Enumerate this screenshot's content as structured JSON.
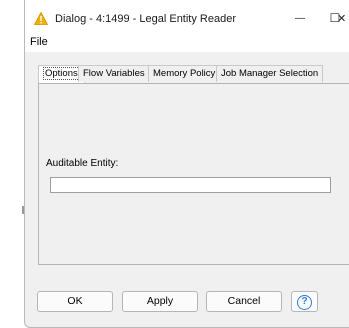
{
  "window": {
    "title": "Dialog - 4:1499 - Legal Entity Reader",
    "minimize_glyph": "—",
    "maximize_glyph": "☐",
    "close_glyph": "✕",
    "icon": "warning-triangle-icon",
    "accent_color": "#f0b400"
  },
  "menu": {
    "items": [
      {
        "label": "File"
      }
    ]
  },
  "tabs": [
    {
      "label": "Options",
      "active": true
    },
    {
      "label": "Flow Variables"
    },
    {
      "label": "Memory Policy"
    },
    {
      "label": "Job Manager Selection"
    }
  ],
  "options": {
    "auditable_entity_label": "Auditable Entity:",
    "auditable_entity_value": ""
  },
  "buttons": {
    "ok": "OK",
    "apply": "Apply",
    "cancel": "Cancel",
    "help": "?"
  }
}
